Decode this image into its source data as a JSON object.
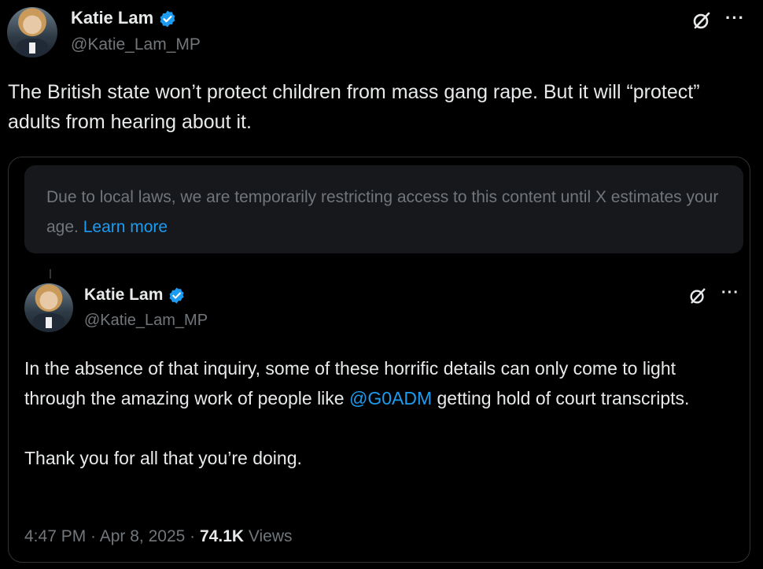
{
  "post": {
    "author_name": "Katie Lam",
    "author_handle": "@Katie_Lam_MP",
    "text": "The British state won’t protect children from mass gang rape. But it will “protect” adults from hearing about it."
  },
  "notice": {
    "text": "Due to local laws, we are temporarily restricting access to this content until X estimates your age.",
    "link": "Learn more"
  },
  "quoted": {
    "author_name": "Katie Lam",
    "author_handle": "@Katie_Lam_MP",
    "text_before": "In the absence of that inquiry, some of these horrific details can only come to light through the amazing work of people like ",
    "mention": "@G0ADM",
    "text_after": " getting hold of court transcripts.",
    "text_2": "Thank you for all that you’re doing.",
    "time": "4:47 PM",
    "sep": " · ",
    "date": "Apr 8, 2025",
    "views_count": "74.1K",
    "views_label": " Views"
  },
  "icons": {
    "verified": "verified-badge-icon",
    "grok": "grok-icon",
    "more": "more-icon"
  },
  "colors": {
    "background": "#000000",
    "accent": "#1d9bf0",
    "muted": "#71767b",
    "text": "#e7e9ea"
  }
}
